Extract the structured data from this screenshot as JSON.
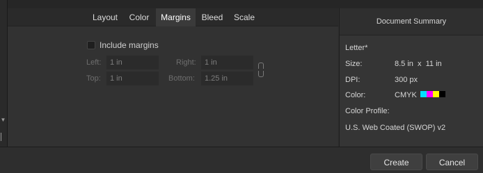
{
  "tabs": [
    {
      "label": "Layout"
    },
    {
      "label": "Color"
    },
    {
      "label": "Margins",
      "active": true
    },
    {
      "label": "Bleed"
    },
    {
      "label": "Scale"
    }
  ],
  "margins": {
    "include_label": "Include margins",
    "include_checked": false,
    "left_label": "Left:",
    "left_value": "1 in",
    "right_label": "Right:",
    "right_value": "1 in",
    "top_label": "Top:",
    "top_value": "1 in",
    "bottom_label": "Bottom:",
    "bottom_value": "1.25 in"
  },
  "summary": {
    "title": "Document Summary",
    "preset": "Letter*",
    "size_label": "Size:",
    "size_value": "8.5 in  x  11 in",
    "dpi_label": "DPI:",
    "dpi_value": "300 px",
    "color_label": "Color:",
    "color_value": "CMYK",
    "cmyk_colors": [
      "#00e0ff",
      "#ff00ff",
      "#ffff00",
      "#000000"
    ],
    "profile_label": "Color Profile:",
    "profile_value": "U.S. Web Coated (SWOP) v2"
  },
  "buttons": {
    "create": "Create",
    "cancel": "Cancel"
  }
}
